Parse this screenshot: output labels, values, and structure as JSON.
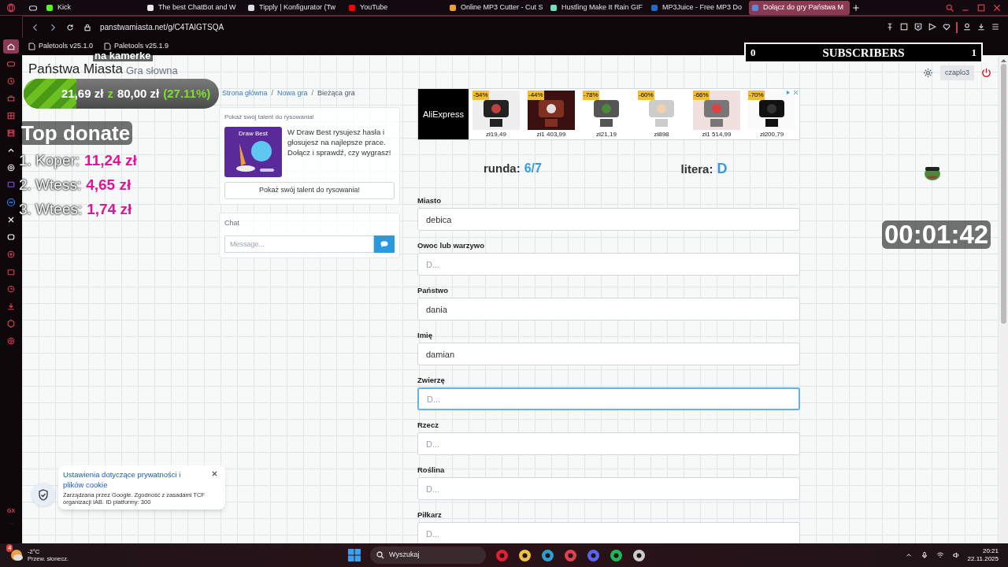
{
  "browser_tabs": [
    {
      "title": "Kick",
      "selected": false
    },
    {
      "title": "The best ChatBot and W",
      "selected": false
    },
    {
      "title": "Tipply | Konfigurator (Tw",
      "selected": false
    },
    {
      "title": "YouTube",
      "selected": false
    },
    {
      "title": "Online MP3 Cutter - Cut S",
      "selected": false
    },
    {
      "title": "Hustling Make It Rain GIF",
      "selected": false
    },
    {
      "title": "MP3Juice - Free MP3 Do",
      "selected": false
    },
    {
      "title": "Dołącz do gry Państwa M",
      "selected": true
    }
  ],
  "address_bar": {
    "url": "panstwamiasta.net/g/C4TAIGTSQA"
  },
  "bookmarks": [
    "Paletools v25.1.0",
    "Paletools v25.1.9"
  ],
  "sidebar": {
    "footer": "GX"
  },
  "site": {
    "title": "Państwa Miasta",
    "subtitle": "Gra słowna",
    "user": "czaplo3"
  },
  "breadcrumb_separator": "/",
  "breadcrumb": [
    {
      "label": "Strona główna",
      "kind": "link"
    },
    {
      "label": "Nowa gra",
      "kind": "link"
    },
    {
      "label": "Bieżąca gra",
      "kind": "current"
    }
  ],
  "promo": {
    "heading": "Pokaż swój talent do rysowania!",
    "image_title": "Draw Best",
    "text": "W Draw Best rysujesz hasła i głosujesz na najlepsze prace. Dołącz i sprawdź, czy wygrasz!",
    "button": "Pokaż swój talent do rysowania!"
  },
  "chat": {
    "title": "Chat",
    "placeholder": "Message..."
  },
  "ad": {
    "brand": "AliExpress",
    "products": [
      {
        "discount": "-54%",
        "price": "zł19,49"
      },
      {
        "discount": "-44%",
        "price": "zł1 403,99"
      },
      {
        "discount": "-78%",
        "price": "zł21,19"
      },
      {
        "discount": "-60%",
        "price": "zł898"
      },
      {
        "discount": "-66%",
        "price": "zł1 514,99"
      },
      {
        "discount": "-70%",
        "price": "zł200,79"
      }
    ]
  },
  "round": {
    "label": "runda:",
    "value": "6/7"
  },
  "letter": {
    "label": "litera:",
    "value": "D"
  },
  "fields": [
    {
      "label": "Miasto",
      "value": "debica",
      "focused": false
    },
    {
      "label": "Owoc lub warzywo",
      "placeholder": "D...",
      "focused": false
    },
    {
      "label": "Państwo",
      "value": "dania",
      "focused": false
    },
    {
      "label": "Imię",
      "value": "damian",
      "focused": false
    },
    {
      "label": "Zwierzę",
      "placeholder": "D...",
      "focused": true
    },
    {
      "label": "Rzecz",
      "placeholder": "D...",
      "focused": false
    },
    {
      "label": "Roślina",
      "placeholder": "D...",
      "focused": false
    },
    {
      "label": "Piłkarz",
      "placeholder": "D...",
      "focused": false
    }
  ],
  "cookie_notice": {
    "title": "Ustawienia dotyczące prywatności i plików cookie",
    "text": "Zarządzana przez Google. Zgodność z zasadami TCF organizacji IAB. ID platformy: 300"
  },
  "stream_overlay": {
    "camera_label": "na kamerke",
    "goal": {
      "raised": "21,69 zł",
      "separator": "z",
      "target": "80,00 zł",
      "percent": "(27.11%)",
      "level": 0.2711
    },
    "top_donate": {
      "title": "Top donate",
      "entries": [
        {
          "rank": "1.",
          "name": "Koper:",
          "amount": "11,24 zł"
        },
        {
          "rank": "2.",
          "name": "Wtess:",
          "amount": "4,65 zł"
        },
        {
          "rank": "3.",
          "name": "Wtees:",
          "amount": "1,74 zł"
        }
      ]
    },
    "subscribers": {
      "current": "0",
      "label": "SUBSCRIBERS",
      "goal": "1"
    },
    "timer": "00:01:42"
  },
  "taskbar": {
    "weather": {
      "badge": "4",
      "temp": "-2°C",
      "text": "Przew. słonecz."
    },
    "search_placeholder": "Wyszukaj",
    "time": "20:21",
    "date": "22.11.2025"
  }
}
